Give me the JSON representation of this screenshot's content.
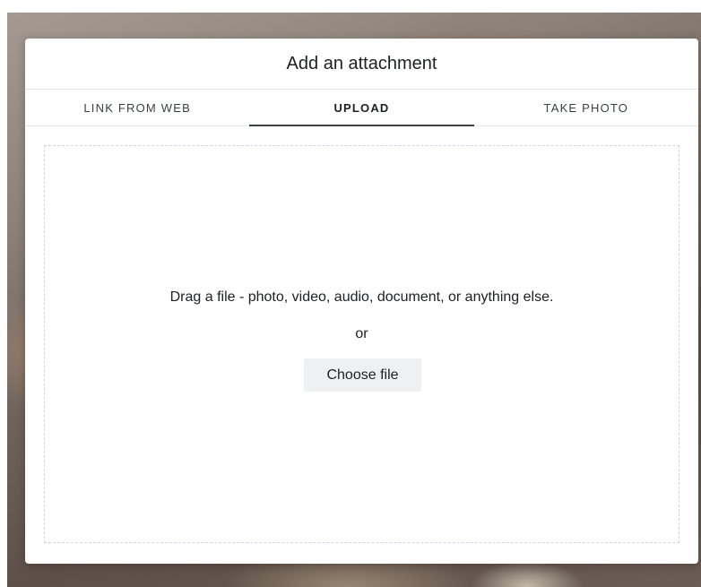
{
  "dialog": {
    "title": "Add an attachment"
  },
  "tabs": [
    {
      "label": "LINK FROM WEB",
      "active": false
    },
    {
      "label": "UPLOAD",
      "active": true
    },
    {
      "label": "TAKE PHOTO",
      "active": false
    }
  ],
  "dropzone": {
    "instruction": "Drag a file - photo, video, audio, document, or anything else.",
    "or_label": "or",
    "choose_label": "Choose file"
  }
}
